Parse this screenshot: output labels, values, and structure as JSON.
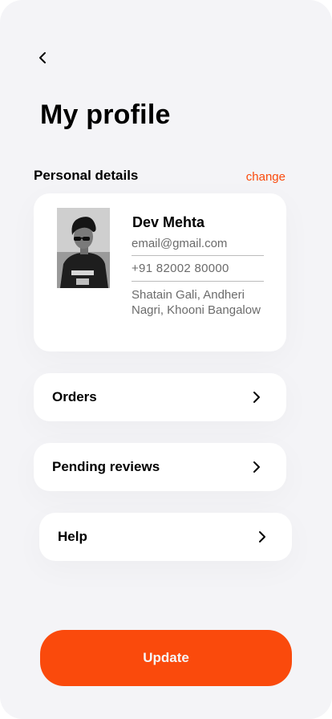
{
  "header": {
    "back_icon": "chevron-left-icon",
    "title": "My profile"
  },
  "personal_details": {
    "section_label": "Personal details",
    "change_label": "change",
    "name": "Dev Mehta",
    "email": "email@gmail.com",
    "phone": "+91 82002 80000",
    "address": "Shatain Gali, Andheri Nagri, Khooni Bangalow"
  },
  "menu": {
    "items": [
      {
        "label": "Orders",
        "icon": "chevron-right-icon"
      },
      {
        "label": "Pending reviews",
        "icon": "chevron-right-icon"
      },
      {
        "label": "Help",
        "icon": "chevron-right-icon"
      }
    ]
  },
  "actions": {
    "update_label": "Update"
  },
  "colors": {
    "accent": "#fa4a0c",
    "background": "#f4f4f7",
    "card": "#ffffff"
  }
}
